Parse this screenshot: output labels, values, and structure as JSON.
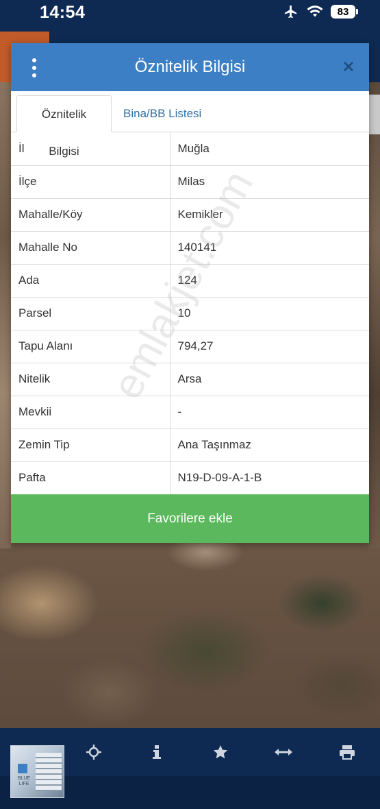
{
  "status_bar": {
    "time": "14:54",
    "battery": "83",
    "icons": [
      "airplane-icon",
      "wifi-icon",
      "battery-icon"
    ]
  },
  "modal": {
    "title": "Öznitelik Bilgisi",
    "menu_icon": "kebab-menu-icon",
    "close_icon": "close-icon",
    "header_color": "#3d7fc4",
    "tabs": [
      {
        "label": "Öznitelik Bilgisi",
        "active": true
      },
      {
        "label": "Bina/BB Listesi",
        "active": false
      }
    ],
    "rows": [
      {
        "key": "İl",
        "value": "Muğla"
      },
      {
        "key": "İlçe",
        "value": "Milas"
      },
      {
        "key": "Mahalle/Köy",
        "value": "Kemikler"
      },
      {
        "key": "Mahalle No",
        "value": "140141"
      },
      {
        "key": "Ada",
        "value": "124"
      },
      {
        "key": "Parsel",
        "value": "10"
      },
      {
        "key": "Tapu Alanı",
        "value": "794,27"
      },
      {
        "key": "Nitelik",
        "value": "Arsa"
      },
      {
        "key": "Mevkii",
        "value": "-"
      },
      {
        "key": "Zemin Tip",
        "value": "Ana Taşınmaz"
      },
      {
        "key": "Pafta",
        "value": "N19-D-09-A-1-B"
      }
    ],
    "favorite_button": "Favorilere ekle",
    "favorite_color": "#5cb85c"
  },
  "watermark": "emlakjet.com",
  "toolbar": {
    "items": [
      "refresh-icon",
      "crosshair-icon",
      "info-icon",
      "star-icon",
      "measure-icon",
      "print-icon"
    ],
    "thumbnail_text": "BLUE LIFE"
  }
}
